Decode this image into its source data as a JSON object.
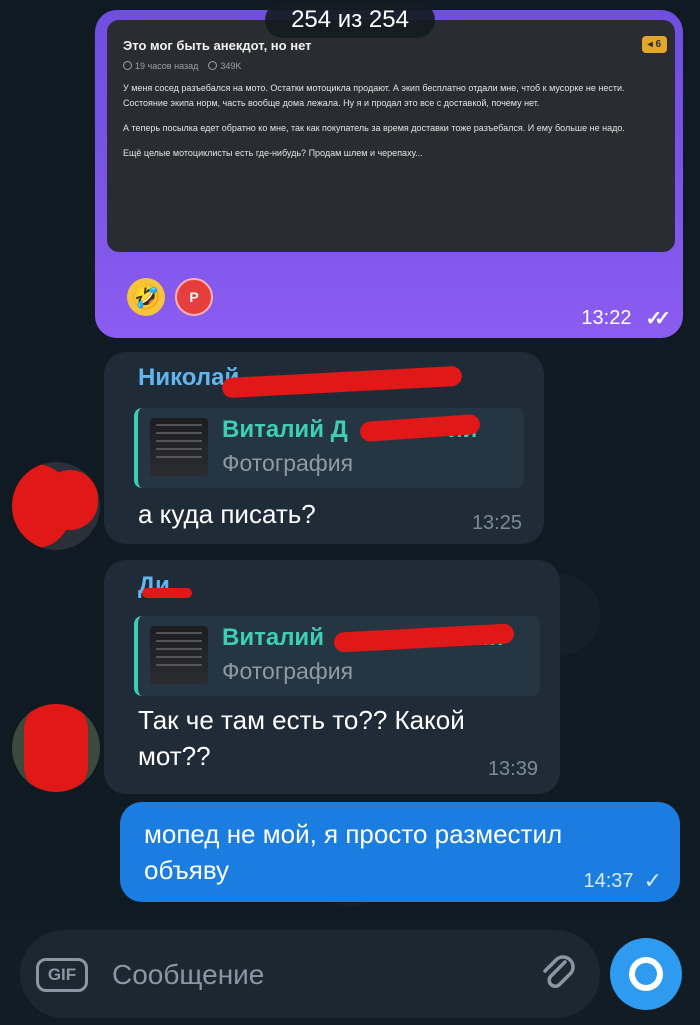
{
  "counter": "254 из 254",
  "forwarded": {
    "post_title": "Это мог быть анекдот, но нет",
    "post_meta_time": "19 часов назад",
    "post_meta_views": "349K",
    "post_badge": "6",
    "post_paragraphs": [
      "У меня сосед разъебался на мото. Остатки мотоцикла продают. А экип бесплатно отдали мне, чтоб к мусорке не нести. Состояние экипа норм, часть вообще дома лежала. Ну я и продал это все с доставкой, почему нет.",
      "А теперь посылка едет обратно ко мне, так как покупатель за время доставки тоже разъебался. И ему больше не надо.",
      "Ещё целые мотоциклисты есть где-нибудь? Продам шлем и черепаху..."
    ],
    "reaction_emoji": "🤣",
    "reaction_avatar_letter": "Р",
    "time": "13:22"
  },
  "messages": [
    {
      "sender": "Николай",
      "reply_name": "Виталий Д",
      "reply_name_end": "ий",
      "reply_sub": "Фотография",
      "text": "а куда писать?",
      "time": "13:25"
    },
    {
      "sender": "Ди",
      "reply_name": "Виталий",
      "reply_name_end": "ий",
      "reply_sub": "Фотография",
      "text": "Так че там есть то?? Какой мот??",
      "time": "13:39"
    }
  ],
  "outgoing": {
    "text": "мопед не мой, я просто разместил объяву",
    "time": "14:37"
  },
  "composer": {
    "gif_label": "GIF",
    "placeholder": "Сообщение"
  },
  "colors": {
    "accent": "#2f9bf0",
    "outgoing_bubble": "#1c7de0",
    "incoming_bubble": "#1f2c37",
    "forward_bubble": "#7a55e6",
    "reply_accent": "#3ccfb5",
    "sender_name": "#62b6f0",
    "redaction": "#e01818"
  }
}
